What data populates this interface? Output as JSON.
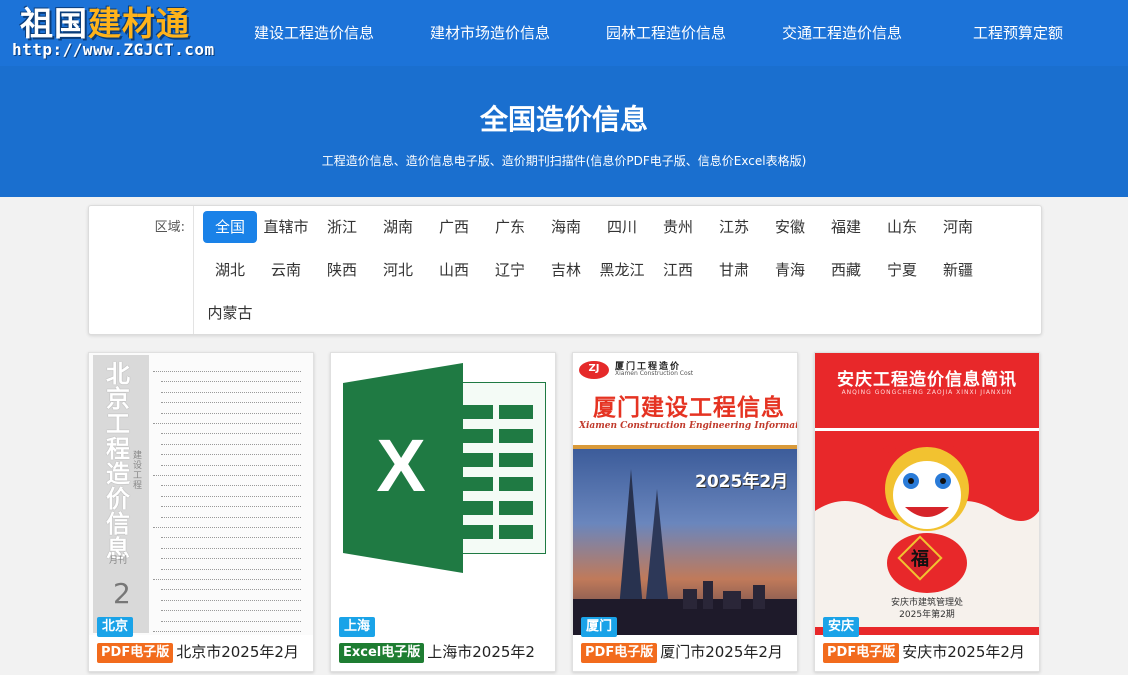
{
  "header": {
    "logo_main_white": "祖国",
    "logo_main_orange": "建材通",
    "logo_url": "http://www.ZGJCT.com",
    "nav": [
      "建设工程造价信息",
      "建材市场造价信息",
      "园林工程造价信息",
      "交通工程造价信息",
      "工程预算定额"
    ]
  },
  "hero": {
    "title": "全国造价信息",
    "subtitle": "工程造价信息、造价信息电子版、造价期刊扫描件(信息价PDF电子版、信息价Excel表格版)"
  },
  "filter": {
    "label": "区域:",
    "selected": "全国",
    "regions": [
      "全国",
      "直辖市",
      "浙江",
      "湖南",
      "广西",
      "广东",
      "海南",
      "四川",
      "贵州",
      "江苏",
      "安徽",
      "福建",
      "山东",
      "河南",
      "湖北",
      "云南",
      "陕西",
      "河北",
      "山西",
      "辽宁",
      "吉林",
      "黑龙江",
      "江西",
      "甘肃",
      "青海",
      "西藏",
      "宁夏",
      "新疆",
      "内蒙古"
    ]
  },
  "colors": {
    "accent": "#1c73d8",
    "pdf_badge": "#f26b1d",
    "excel_badge": "#1e7d32",
    "city_tag": "#1aa3e8",
    "selected_region": "#1a82e8"
  },
  "cards": [
    {
      "city": "北京",
      "format": "PDF电子版",
      "title": "北京市2025年2月",
      "cover": {
        "vertical_title": "北京工程造价信息",
        "subtitle": "建设工程",
        "period": "月刊",
        "number": "2"
      }
    },
    {
      "city": "上海",
      "format": "Excel电子版",
      "title": "上海市2025年2",
      "cover": {
        "icon": "excel-icon",
        "letter": "X"
      }
    },
    {
      "city": "厦门",
      "format": "PDF电子版",
      "title": "厦门市2025年2月",
      "cover": {
        "logo": "ZJ",
        "header": "厦门工程造价",
        "header_en": "Xiamen Construction Cost",
        "main_title": "厦门建设工程信息",
        "english": "Xiamen Construction Engineering Information",
        "date": "2025年2月"
      }
    },
    {
      "city": "安庆",
      "format": "PDF电子版",
      "title": "安庆市2025年2月",
      "cover": {
        "main_title": "安庆工程造价信息简讯",
        "english": "ANQING GONGCHENG ZAOJIA XINXI JIANXUN",
        "fu": "福",
        "footer_1": "安庆市建筑管理处",
        "footer_2": "2025年第2期"
      }
    }
  ]
}
